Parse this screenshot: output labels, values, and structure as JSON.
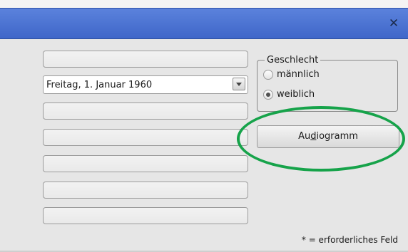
{
  "dialog": {
    "close_glyph": "✕",
    "title_color": "#4a71d2",
    "fields": {
      "birthdate": "Freitag, 1. Januar 1960"
    },
    "gender": {
      "legend": "Geschlecht",
      "options": [
        {
          "label": "männlich",
          "selected": false
        },
        {
          "label": "weiblich",
          "selected": true
        }
      ]
    },
    "audiogram_button": {
      "pre": "Au",
      "mnemonic": "d",
      "post": "iogramm"
    },
    "footer_note": "* = erforderliches Feld",
    "highlight_color": "#16a34a"
  }
}
